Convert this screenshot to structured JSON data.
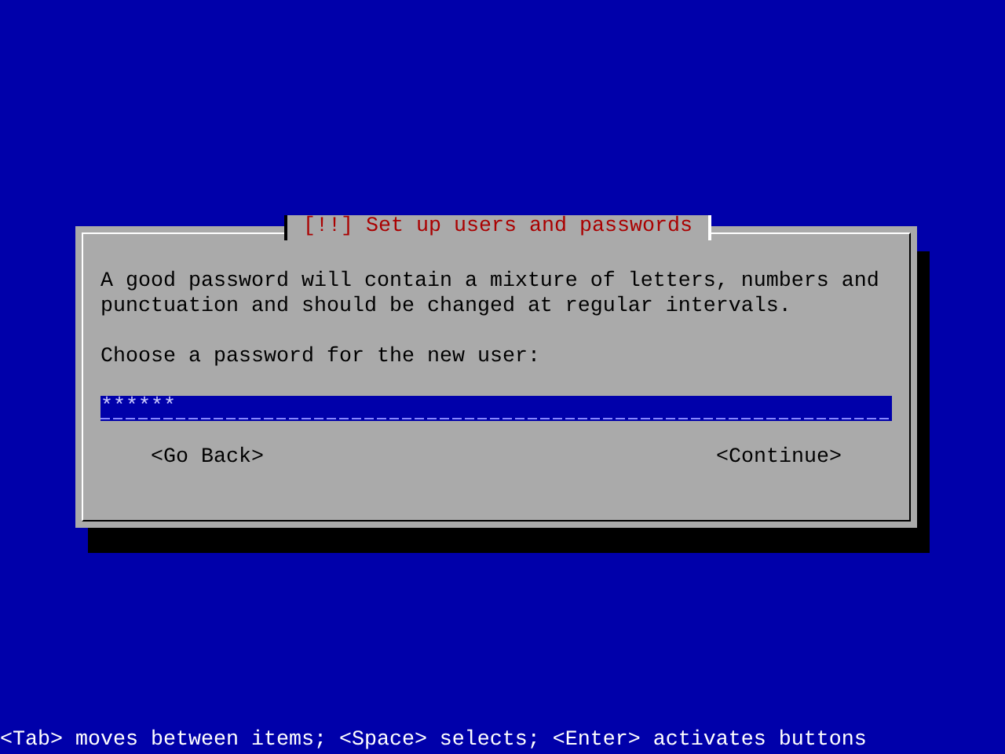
{
  "dialog": {
    "title": "[!!] Set up users and passwords",
    "message": "A good password will contain a mixture of letters, numbers and punctuation and should be changed at regular intervals.",
    "prompt": "Choose a password for the new user:",
    "password_field": {
      "value": "******"
    },
    "buttons": [
      {
        "label": "<Go Back>"
      },
      {
        "label": "<Continue>"
      }
    ]
  },
  "help_line": "<Tab> moves between items; <Space> selects; <Enter> activates buttons"
}
